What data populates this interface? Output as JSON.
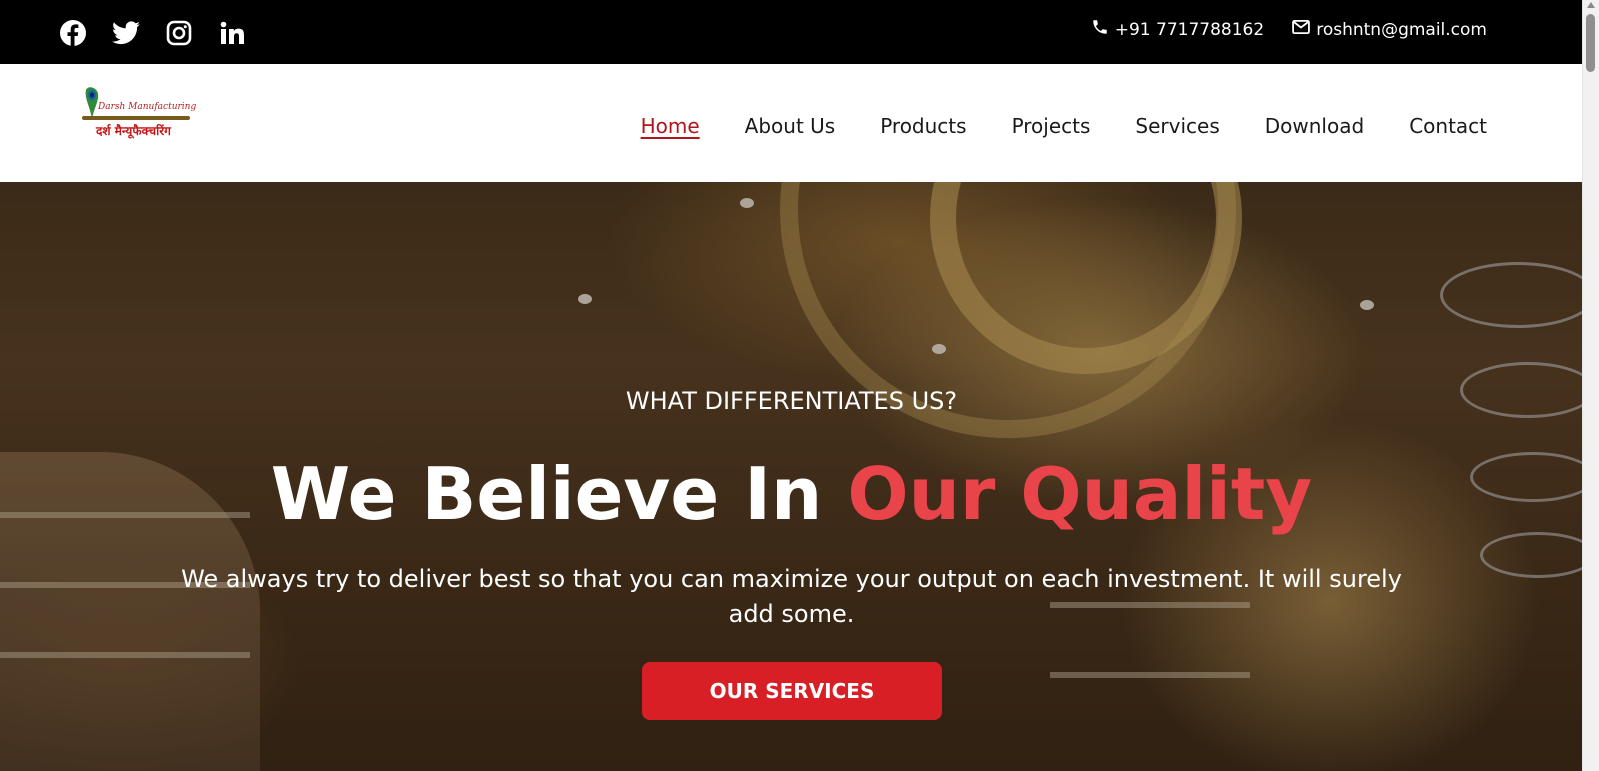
{
  "topbar": {
    "socials": [
      {
        "icon": "facebook-icon"
      },
      {
        "icon": "twitter-icon"
      },
      {
        "icon": "instagram-icon"
      },
      {
        "icon": "linkedin-icon"
      }
    ],
    "phone": "+91 7717788162",
    "email": "roshntn@gmail.com"
  },
  "header": {
    "logo": {
      "english": "Darsh Manufacturing",
      "hindi": "दर्श मैन्यूफैक्चरिंग"
    },
    "nav": [
      {
        "label": "Home",
        "active": true
      },
      {
        "label": "About Us"
      },
      {
        "label": "Products"
      },
      {
        "label": "Projects"
      },
      {
        "label": "Services"
      },
      {
        "label": "Download"
      },
      {
        "label": "Contact"
      }
    ]
  },
  "hero": {
    "eyebrow": "WHAT DIFFERENTIATES US?",
    "headline_part1": "We Believe In ",
    "headline_highlight": "Our Quality",
    "subtext": "We always try to deliver best so that you can maximize your output on each investment. It will surely add some.",
    "cta_label": "OUR SERVICES"
  },
  "colors": {
    "topbar_bg": "#000000",
    "nav_active": "#b0151c",
    "highlight": "#e8444a",
    "cta_bg": "#d81f26"
  }
}
